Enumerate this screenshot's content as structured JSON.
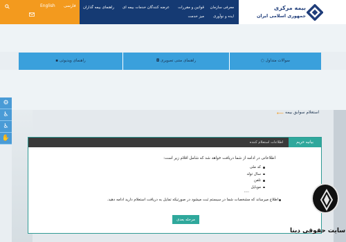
{
  "header": {
    "lang_fa": "فارسی",
    "lang_en": "English",
    "nav": [
      "معرفی سازمان",
      "قوانین و مقررات",
      "عرضه کنندگان خدمات بیمه ای",
      "راهنمای بیمه گذاران",
      "ایده و نوآوری",
      "میز خدمت"
    ],
    "logo_line1": "بیمه مرکزی",
    "logo_line2": "جمهوری اسلامی ایران",
    "icons": [
      "search-icon",
      "mail-icon"
    ]
  },
  "bluebar": {
    "items": [
      "سوالات متداول",
      "راهنمای متنی تصویری",
      "راهنمای ویدیوئی"
    ]
  },
  "toolbar": {
    "icons": [
      "gear-icon",
      "accessibility-icon",
      "wheelchair-icon",
      "sign-language-icon"
    ]
  },
  "breadcrumb": "استعلام سوابق بیمه",
  "card": {
    "tab_active": "بیانیه حریم خصوصی",
    "tab_inactive": "اطلاعات استعلام کننده",
    "intro": "اطلاعاتی در ادامه از شما دریافت خواهد شد که شامل اقلام زیر است:",
    "items": [
      "کد ملی",
      "سال تولد",
      "تلفن",
      "موبایل"
    ],
    "dots": "....",
    "notice": "اطلاع میرساند که مشخصات شما در سیستم ثبت میشود در صورتیکه تمایل به دریافت استعلام دارید ادامه دهید.",
    "next_button": "مرحله بعدی"
  },
  "watermark": "سایت حقوقی دینا",
  "colors": {
    "navy": "#153a73",
    "orange": "#f39a1e",
    "blue": "#3aa0dc",
    "teal": "#2fa89c"
  }
}
